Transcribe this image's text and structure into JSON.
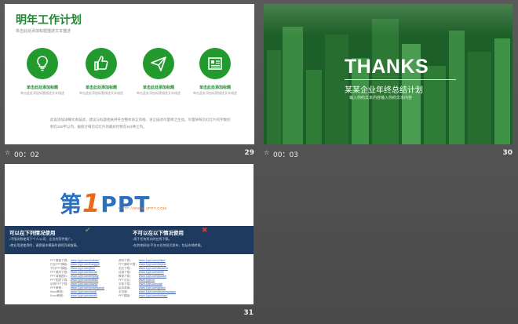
{
  "slides": [
    {
      "title": "明年工作计划",
      "subtitle": "单击此处添加标题描述文本描述",
      "items": [
        {
          "icon": "lightbulb-icon",
          "title": "单击此处添加标题",
          "desc": "单击此处添加标题描述文本描述"
        },
        {
          "icon": "thumbs-up-icon",
          "title": "单击此处添加标题",
          "desc": "单击此处添加标题描述文本描述"
        },
        {
          "icon": "paper-plane-icon",
          "title": "单击此处添加标题",
          "desc": "单击此处添加标题描述文本描述"
        },
        {
          "icon": "newspaper-icon",
          "title": "单击此处添加标题",
          "desc": "单击此处添加标题描述文本描述"
        }
      ],
      "footer": "此处添加详细文本描述，建议与标题相关并符合整体语言风格，语言描述尽量简洁生动。尽量将每页幻灯片的字数控制在200字以内，据统计每页幻灯片的最好控制在5分钟之内。",
      "transition_icon": "☆",
      "time": "00：02",
      "number": "29"
    },
    {
      "thanks": "THANKS",
      "summary": "某某企业年终总结计划",
      "hint": "输入你的文本内容输入你的文本内容",
      "transition_icon": "☆",
      "time": "00：03",
      "number": "30"
    },
    {
      "logo_prefix": "第",
      "logo_one": "1",
      "logo_suffix": "PPT",
      "logo_url": "HTTP://WWW.1PPT.COM",
      "can_title": "可以在下列情况使用",
      "can_lines": [
        "•不限次数使用于个人/公司、企业的宣传推广。",
        "•商业用途使用时，请保留本模板的说明页或链接。"
      ],
      "cannot_title": "不可以在以下情况使用",
      "cannot_lines": [
        "•用于任何形式的在线下载。",
        "•在其他网站/平台以任何形式发布，包括本地转载。"
      ],
      "links_left": [
        {
          "label": "PPT模板下载：",
          "url": "www.1ppt.com/moban/"
        },
        {
          "label": "行业PPT模板：",
          "url": "www.1ppt.com/hangye/"
        },
        {
          "label": "节日PPT模板：",
          "url": "www.1ppt.com/jieri/"
        },
        {
          "label": "PPT素材下载：",
          "url": "www.1ppt.com/sucai/"
        },
        {
          "label": "PPT背景图片：",
          "url": "www.1ppt.com/beijing/"
        },
        {
          "label": "PPT图表下载：",
          "url": "www.1ppt.com/tubiao/"
        },
        {
          "label": "优秀PPT下载：",
          "url": "www.1ppt.com/xiazai/"
        },
        {
          "label": "PPT教程：",
          "url": "www.1ppt.com/powerpoint/"
        },
        {
          "label": "Word教程：",
          "url": "www.1ppt.com/word/"
        },
        {
          "label": "Excel教程：",
          "url": "www.1ppt.com/excel/"
        }
      ],
      "links_right": [
        {
          "label": "资料下载：",
          "url": "www.1ppt.com/ziliao/"
        },
        {
          "label": "PPT课件下载：",
          "url": "www.1ppt.com/kejian/"
        },
        {
          "label": "范文下载：",
          "url": "www.1ppt.com/fanwen/"
        },
        {
          "label": "试卷下载：",
          "url": "www.1ppt.com/shiti/"
        },
        {
          "label": "教案下载：",
          "url": "www.1ppt.com/jiaoan/"
        },
        {
          "label": "PPT论坛：",
          "url": "www.1ppt.cn"
        },
        {
          "label": "字体下载：",
          "url": "www.1ppt.com/ziti/"
        },
        {
          "label": "绘本故事：",
          "url": "www.1ppt.com/gushi/"
        },
        {
          "label": "手抄报：",
          "url": "www.1ppt.com/shouchaobao/"
        },
        {
          "label": "PPT模板：",
          "url": "www.1ppt.com/moban/"
        }
      ],
      "number": "31"
    }
  ],
  "colors": {
    "green": "#239a2e",
    "navy": "#1e3a5f",
    "logo_blue": "#2c6fbf",
    "logo_orange": "#e96a1a"
  }
}
